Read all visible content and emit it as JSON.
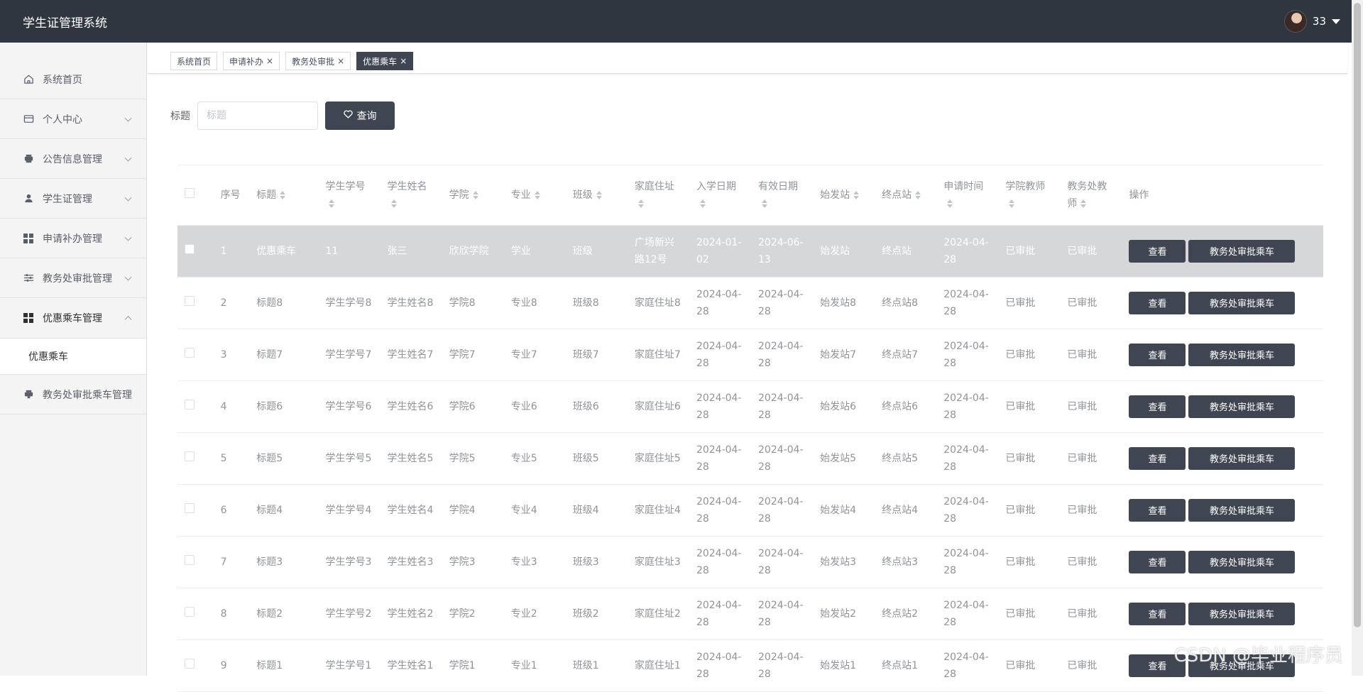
{
  "header": {
    "app_title": "学生证管理系统",
    "username": "33"
  },
  "sidebar": {
    "items": [
      {
        "label": "系统首页",
        "icon": "home-icon"
      },
      {
        "label": "个人中心",
        "icon": "card-icon"
      },
      {
        "label": "公告信息管理",
        "icon": "printer-icon"
      },
      {
        "label": "学生证管理",
        "icon": "user-icon"
      },
      {
        "label": "申请补办管理",
        "icon": "grid-icon"
      },
      {
        "label": "教务处审批管理",
        "icon": "sliders-icon"
      },
      {
        "label": "优惠乘车管理",
        "icon": "grid-icon"
      },
      {
        "label": "教务处审批乘车管理",
        "icon": "printer-icon"
      }
    ],
    "submenu": {
      "label": "优惠乘车"
    }
  },
  "tags": [
    {
      "label": "系统首页"
    },
    {
      "label": "申请补办",
      "close": "×"
    },
    {
      "label": "教务处审批",
      "close": "×"
    },
    {
      "label": "优惠乘车",
      "close": "×"
    }
  ],
  "search": {
    "label": "标题",
    "placeholder": "标题",
    "button_label": "查询"
  },
  "table": {
    "headers": {
      "index": "序号",
      "title": "标题",
      "student_no": "学生学号",
      "student_name": "学生姓名",
      "college": "学院",
      "major": "专业",
      "class": "班级",
      "address": "家庭住址",
      "enroll_date": "入学日期",
      "valid_date": "有效日期",
      "start_station": "始发站",
      "end_station": "终点站",
      "apply_time": "申请时间",
      "college_teacher": "学院教师",
      "office_teacher": "教务处教师",
      "actions": "操作"
    },
    "view_label": "查看",
    "approve_label": "教务处审批乘车",
    "rows": [
      {
        "index": "1",
        "title": "优惠乘车",
        "student_no": "11",
        "student_name": "张三",
        "college": "欣欣学院",
        "major": "学业",
        "class": "班级",
        "address": "广场新兴路12号",
        "enroll_date": "2024-01-02",
        "valid_date": "2024-06-13",
        "start_station": "始发站",
        "end_station": "终点站",
        "apply_time": "2024-04-28",
        "college_teacher": "已审批",
        "office_teacher": "已审批"
      },
      {
        "index": "2",
        "title": "标题8",
        "student_no": "学生学号8",
        "student_name": "学生姓名8",
        "college": "学院8",
        "major": "专业8",
        "class": "班级8",
        "address": "家庭住址8",
        "enroll_date": "2024-04-28",
        "valid_date": "2024-04-28",
        "start_station": "始发站8",
        "end_station": "终点站8",
        "apply_time": "2024-04-28",
        "college_teacher": "已审批",
        "office_teacher": "已审批"
      },
      {
        "index": "3",
        "title": "标题7",
        "student_no": "学生学号7",
        "student_name": "学生姓名7",
        "college": "学院7",
        "major": "专业7",
        "class": "班级7",
        "address": "家庭住址7",
        "enroll_date": "2024-04-28",
        "valid_date": "2024-04-28",
        "start_station": "始发站7",
        "end_station": "终点站7",
        "apply_time": "2024-04-28",
        "college_teacher": "已审批",
        "office_teacher": "已审批"
      },
      {
        "index": "4",
        "title": "标题6",
        "student_no": "学生学号6",
        "student_name": "学生姓名6",
        "college": "学院6",
        "major": "专业6",
        "class": "班级6",
        "address": "家庭住址6",
        "enroll_date": "2024-04-28",
        "valid_date": "2024-04-28",
        "start_station": "始发站6",
        "end_station": "终点站6",
        "apply_time": "2024-04-28",
        "college_teacher": "已审批",
        "office_teacher": "已审批"
      },
      {
        "index": "5",
        "title": "标题5",
        "student_no": "学生学号5",
        "student_name": "学生姓名5",
        "college": "学院5",
        "major": "专业5",
        "class": "班级5",
        "address": "家庭住址5",
        "enroll_date": "2024-04-28",
        "valid_date": "2024-04-28",
        "start_station": "始发站5",
        "end_station": "终点站5",
        "apply_time": "2024-04-28",
        "college_teacher": "已审批",
        "office_teacher": "已审批"
      },
      {
        "index": "6",
        "title": "标题4",
        "student_no": "学生学号4",
        "student_name": "学生姓名4",
        "college": "学院4",
        "major": "专业4",
        "class": "班级4",
        "address": "家庭住址4",
        "enroll_date": "2024-04-28",
        "valid_date": "2024-04-28",
        "start_station": "始发站4",
        "end_station": "终点站4",
        "apply_time": "2024-04-28",
        "college_teacher": "已审批",
        "office_teacher": "已审批"
      },
      {
        "index": "7",
        "title": "标题3",
        "student_no": "学生学号3",
        "student_name": "学生姓名3",
        "college": "学院3",
        "major": "专业3",
        "class": "班级3",
        "address": "家庭住址3",
        "enroll_date": "2024-04-28",
        "valid_date": "2024-04-28",
        "start_station": "始发站3",
        "end_station": "终点站3",
        "apply_time": "2024-04-28",
        "college_teacher": "已审批",
        "office_teacher": "已审批"
      },
      {
        "index": "8",
        "title": "标题2",
        "student_no": "学生学号2",
        "student_name": "学生姓名2",
        "college": "学院2",
        "major": "专业2",
        "class": "班级2",
        "address": "家庭住址2",
        "enroll_date": "2024-04-28",
        "valid_date": "2024-04-28",
        "start_station": "始发站2",
        "end_station": "终点站2",
        "apply_time": "2024-04-28",
        "college_teacher": "已审批",
        "office_teacher": "已审批"
      },
      {
        "index": "9",
        "title": "标题1",
        "student_no": "学生学号1",
        "student_name": "学生姓名1",
        "college": "学院1",
        "major": "专业1",
        "class": "班级1",
        "address": "家庭住址1",
        "enroll_date": "2024-04-28",
        "valid_date": "2024-04-28",
        "start_station": "始发站1",
        "end_station": "终点站1",
        "apply_time": "2024-04-28",
        "college_teacher": "已审批",
        "office_teacher": "已审批"
      }
    ]
  },
  "watermark": "CSDN @毕业程序员"
}
